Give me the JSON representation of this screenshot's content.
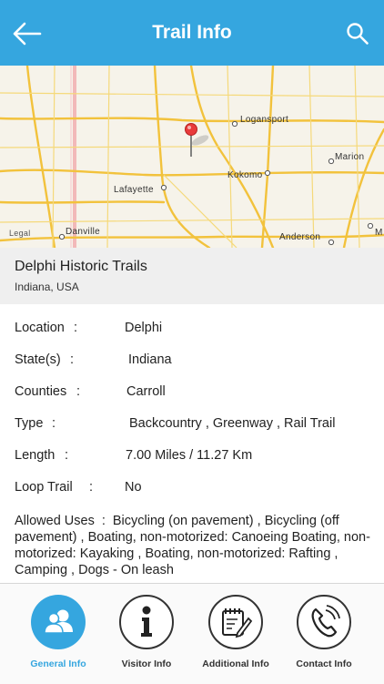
{
  "header": {
    "title": "Trail Info"
  },
  "map": {
    "labels": {
      "logansport": "Logansport",
      "marion": "Marion",
      "kokomo": "Kokomo",
      "lafayette": "Lafayette",
      "danville": "Danville",
      "anderson": "Anderson",
      "m": "M",
      "legal": "Legal"
    }
  },
  "trail": {
    "name": "Delphi Historic Trails",
    "region": "Indiana, USA"
  },
  "details": {
    "location_label": "Location",
    "location_value": "Delphi",
    "state_label": "State(s)",
    "state_value": "Indiana",
    "counties_label": "Counties",
    "counties_value": "Carroll",
    "type_label": "Type",
    "type_value": "Backcountry , Greenway , Rail Trail",
    "length_label": "Length",
    "length_value": "7.00 Miles / 11.27 Km",
    "loop_label": "Loop Trail",
    "loop_value": "No",
    "sep": ":",
    "allowed_label": "Allowed Uses",
    "allowed_value": "Bicycling (on pavement) , Bicycling (off pavement) , Boating, non-motorized: Canoeing Boating, non-motorized: Kayaking , Boating, non-motorized: Rafting , Camping , Dogs - On leash"
  },
  "nav": {
    "general": "General Info",
    "visitor": "Visitor Info",
    "additional": "Additional Info",
    "contact": "Contact Info"
  },
  "colors": {
    "accent": "#35a6df",
    "road": "#f2c23c",
    "map_bg": "#f6f3ea"
  }
}
